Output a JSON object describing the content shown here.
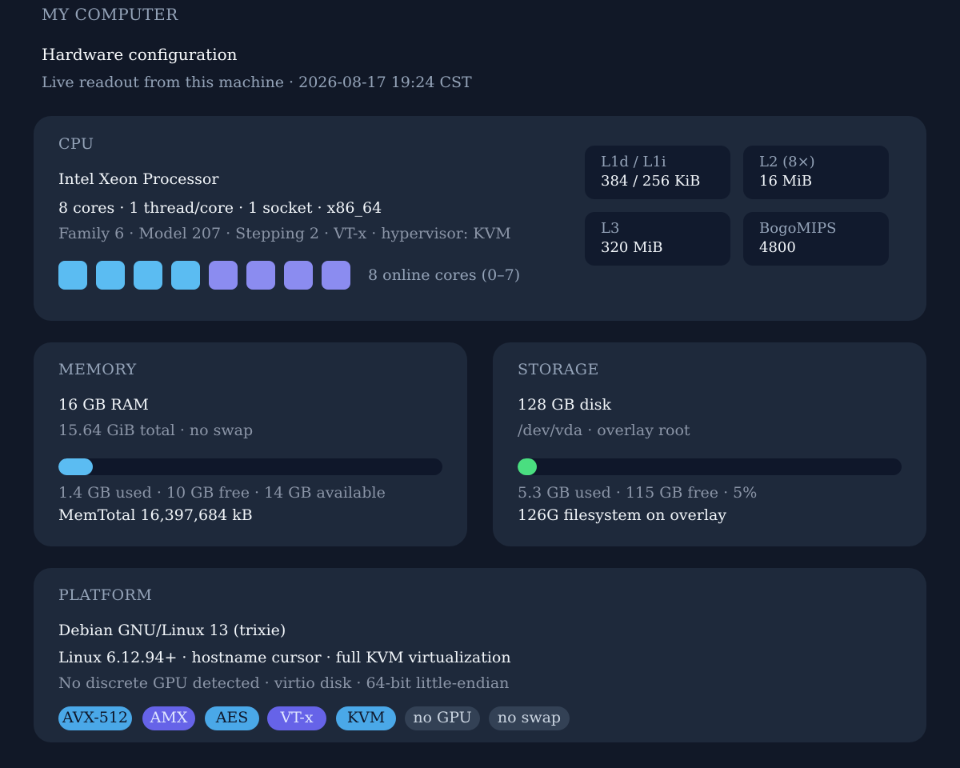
{
  "header": {
    "eyebrow": "MY COMPUTER",
    "title": "Hardware configuration",
    "subtitle": "Live readout from this machine · 2026-08-17 19:24 CST"
  },
  "cpu": {
    "label": "CPU",
    "model": "Intel Xeon Processor",
    "topology": "8 cores · 1 thread/core · 1 socket · x86_64",
    "details": "Family 6 · Model 207 · Stepping 2 · VT-x · hypervisor: KVM",
    "cores_label": "8 online cores (0–7)",
    "core_colors": [
      "#5bbcf2",
      "#5bbcf2",
      "#5bbcf2",
      "#5bbcf2",
      "#8b8cf0",
      "#8b8cf0",
      "#8b8cf0",
      "#8b8cf0"
    ],
    "stats": [
      {
        "label": "L1d / L1i",
        "value": "384 / 256 KiB"
      },
      {
        "label": "L2 (8×)",
        "value": "16 MiB"
      },
      {
        "label": "L3",
        "value": "320 MiB"
      },
      {
        "label": "BogoMIPS",
        "value": "4800"
      }
    ]
  },
  "memory": {
    "label": "MEMORY",
    "headline": "16 GB RAM",
    "detail": "15.64 GiB total · no swap",
    "usage_fraction": 0.09,
    "bar_color": "#5bbcf2",
    "usage_text": "1.4 GB used · 10 GB free · 14 GB available",
    "raw": "MemTotal 16,397,684 kB"
  },
  "storage": {
    "label": "STORAGE",
    "headline": "128 GB disk",
    "detail": "/dev/vda · overlay root",
    "usage_fraction": 0.05,
    "bar_color": "#4ade80",
    "usage_text": "5.3 GB used · 115 GB free · 5%",
    "raw": "126G filesystem on overlay"
  },
  "platform": {
    "label": "PLATFORM",
    "os": "Debian GNU/Linux 13 (trixie)",
    "kernel": "Linux 6.12.94+ · hostname cursor · full KVM virtualization",
    "details": "No discrete GPU detected · virtio disk · 64-bit little-endian",
    "tags": [
      {
        "text": "AVX-512",
        "style": "blue"
      },
      {
        "text": "AMX",
        "style": "purple"
      },
      {
        "text": "AES",
        "style": "blue"
      },
      {
        "text": "VT-x",
        "style": "purple"
      },
      {
        "text": "KVM",
        "style": "blue"
      },
      {
        "text": "no GPU",
        "style": "gray"
      },
      {
        "text": "no swap",
        "style": "gray"
      }
    ]
  }
}
